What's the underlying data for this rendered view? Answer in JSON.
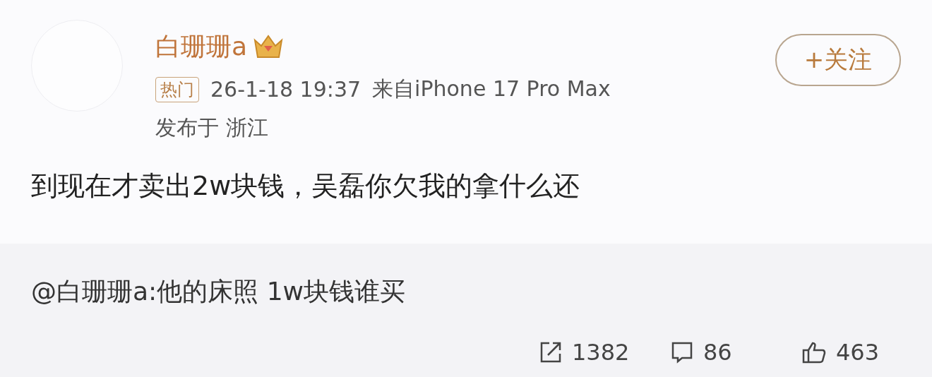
{
  "post": {
    "author": "白珊珊a",
    "follow_button": "+关注",
    "hot_tag": "热门",
    "time": "26-1-18 19:37",
    "source": "来自iPhone 17 Pro Max",
    "location": "发布于 浙江",
    "text": "到现在才卖出2w块钱，吴磊你欠我的拿什么还"
  },
  "quoted": {
    "text": "@白珊珊a:他的床照 1w块钱谁买"
  },
  "actions": [
    {
      "kind": "repost",
      "count": "1382"
    },
    {
      "kind": "comment",
      "count": "86"
    },
    {
      "kind": "like",
      "count": "463"
    }
  ]
}
